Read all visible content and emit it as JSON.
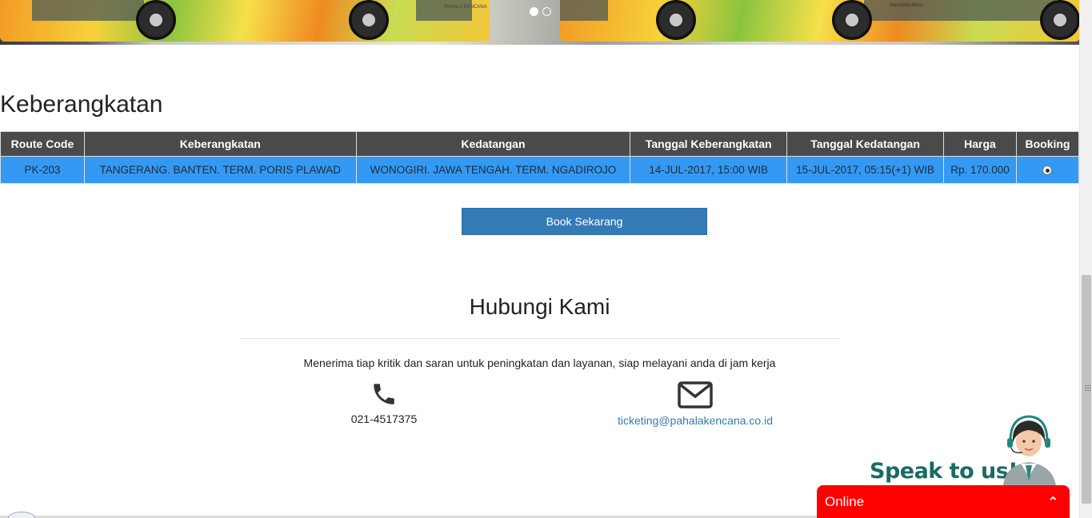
{
  "carousel": {
    "slide_count": 2,
    "active_index": 0
  },
  "bus_tags": {
    "left": "PAHALA KENCANA",
    "right": "Mercedes-Benz"
  },
  "section_title": "Keberangkatan",
  "table": {
    "headers": [
      "Route Code",
      "Keberangkatan",
      "Kedatangan",
      "Tanggal Keberangkatan",
      "Tanggal Kedatangan",
      "Harga",
      "Booking"
    ],
    "rows": [
      {
        "route_code": "PK-203",
        "departure": "TANGERANG. BANTEN. TERM. PORIS PLAWAD",
        "arrival": "WONOGIRI. JAWA TENGAH. TERM. NGADIROJO",
        "departure_date": "14-JUL-2017, 15:00 WIB",
        "arrival_date": "15-JUL-2017, 05:15(+1) WIB",
        "price": "Rp. 170.000",
        "booking_selected": true
      }
    ],
    "header_bg": "#4a4a4a",
    "row_bg": "#3399f3"
  },
  "book_button": {
    "label": "Book Sekarang",
    "color": "#337ab7"
  },
  "contact": {
    "title": "Hubungi Kami",
    "description": "Menerima tiap kritik dan saran untuk peningkatan dan layanan, siap melayani anda di jam kerja",
    "phone": "021-4517375",
    "phone_icon": "phone-icon",
    "email": "ticketing@pahalakencana.co.id",
    "email_icon": "envelope-icon"
  },
  "chat_widget": {
    "speak_text": "Speak to us!",
    "status": "Online",
    "toggle_icon": "chevron-up-icon",
    "bar_color": "#ff0000",
    "text_color": "#1a6b63"
  }
}
